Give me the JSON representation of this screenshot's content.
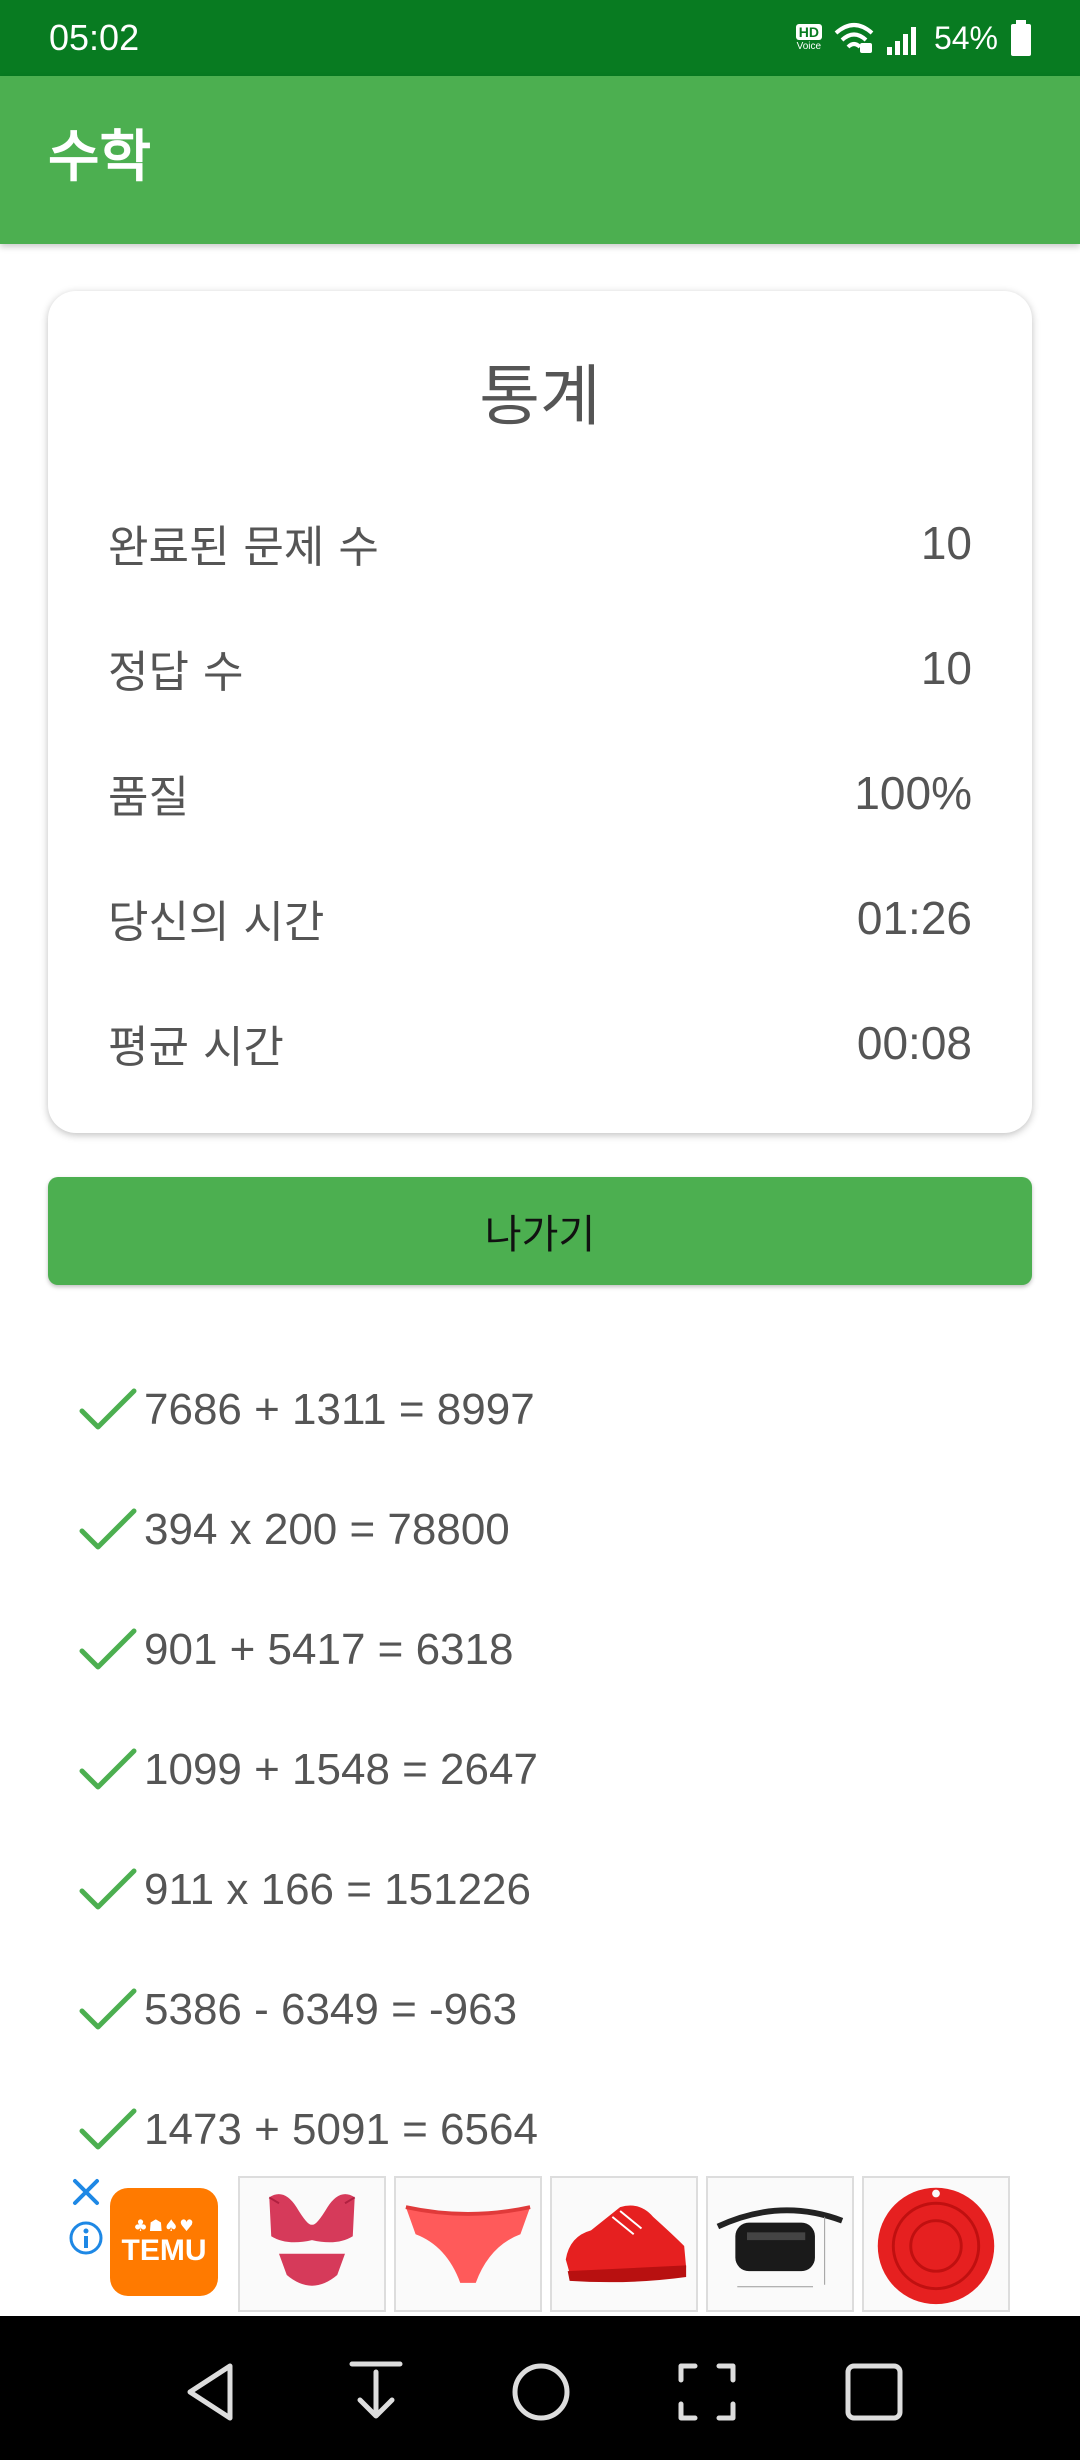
{
  "status_bar": {
    "time": "05:02",
    "hd_label": "HD",
    "voice_label": "Voice",
    "battery": "54%"
  },
  "app_bar": {
    "title": "수학"
  },
  "stats": {
    "title": "통계",
    "rows": [
      {
        "label": "완료된 문제 수",
        "value": "10"
      },
      {
        "label": "정답 수",
        "value": "10"
      },
      {
        "label": "품질",
        "value": "100%"
      },
      {
        "label": "당신의 시간",
        "value": "01:26"
      },
      {
        "label": "평균 시간",
        "value": "00:08"
      }
    ]
  },
  "exit_button": {
    "label": "나가기"
  },
  "problems": [
    {
      "text": "7686 + 1311 = 8997",
      "correct": true
    },
    {
      "text": "394 x 200 = 78800",
      "correct": true
    },
    {
      "text": "901 + 5417 = 6318",
      "correct": true
    },
    {
      "text": "1099 + 1548 = 2647",
      "correct": true
    },
    {
      "text": "911 x 166 = 151226",
      "correct": true
    },
    {
      "text": "5386 - 6349 = -963",
      "correct": true
    },
    {
      "text": "1473 + 5091 = 6564",
      "correct": true
    }
  ],
  "ad": {
    "brand": "TEMU",
    "brand_glyphs": "♣☗♠♥",
    "products": [
      "lingerie-set",
      "red-briefs",
      "red-sneaker",
      "black-waist-bag",
      "red-silicone-mat"
    ]
  },
  "colors": {
    "status_bar": "#087b21",
    "accent": "#4caf50",
    "check": "#4caf50",
    "temu": "#ff7a00"
  }
}
